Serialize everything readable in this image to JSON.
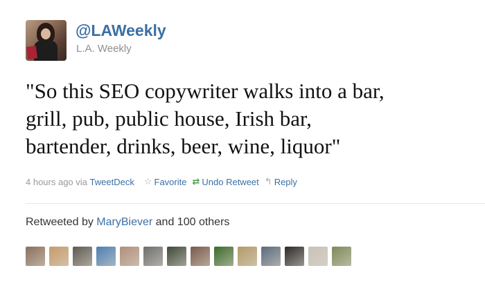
{
  "author": {
    "screen_name": "@LAWeekly",
    "full_name": "L.A. Weekly",
    "avatar_icon": "user-avatar-photo"
  },
  "tweet": {
    "text": "\"So this SEO copywriter walks into a bar,\ngrill, pub, public house, Irish bar,\nbartender, drinks, beer, wine, liquor\""
  },
  "meta": {
    "time": "4 hours ago",
    "via_label": "via",
    "source": "TweetDeck",
    "favorite": "Favorite",
    "undo_retweet": "Undo Retweet",
    "reply": "Reply"
  },
  "retweets": {
    "prefix": "Retweeted by",
    "user": "MaryBiever",
    "suffix": "and 100 others"
  },
  "retweeter_avatars": [
    {
      "icon": "retweeter-avatar",
      "color": "#8a6f5b"
    },
    {
      "icon": "retweeter-avatar",
      "color": "#c79a6a"
    },
    {
      "icon": "retweeter-avatar",
      "color": "#5e5a52"
    },
    {
      "icon": "retweeter-avatar",
      "color": "#4d7fb2"
    },
    {
      "icon": "retweeter-avatar",
      "color": "#b08f7a"
    },
    {
      "icon": "retweeter-avatar",
      "color": "#6e6e6e"
    },
    {
      "icon": "retweeter-avatar",
      "color": "#3f4a3a"
    },
    {
      "icon": "retweeter-avatar",
      "color": "#7a5a4a"
    },
    {
      "icon": "retweeter-avatar",
      "color": "#3c6a2c"
    },
    {
      "icon": "retweeter-avatar",
      "color": "#b49a68"
    },
    {
      "icon": "retweeter-avatar",
      "color": "#5a6b7a"
    },
    {
      "icon": "retweeter-avatar",
      "color": "#2a2a2a"
    },
    {
      "icon": "retweeter-avatar",
      "color": "#c9c2b8"
    },
    {
      "icon": "retweeter-avatar",
      "color": "#7c8a5a"
    }
  ]
}
